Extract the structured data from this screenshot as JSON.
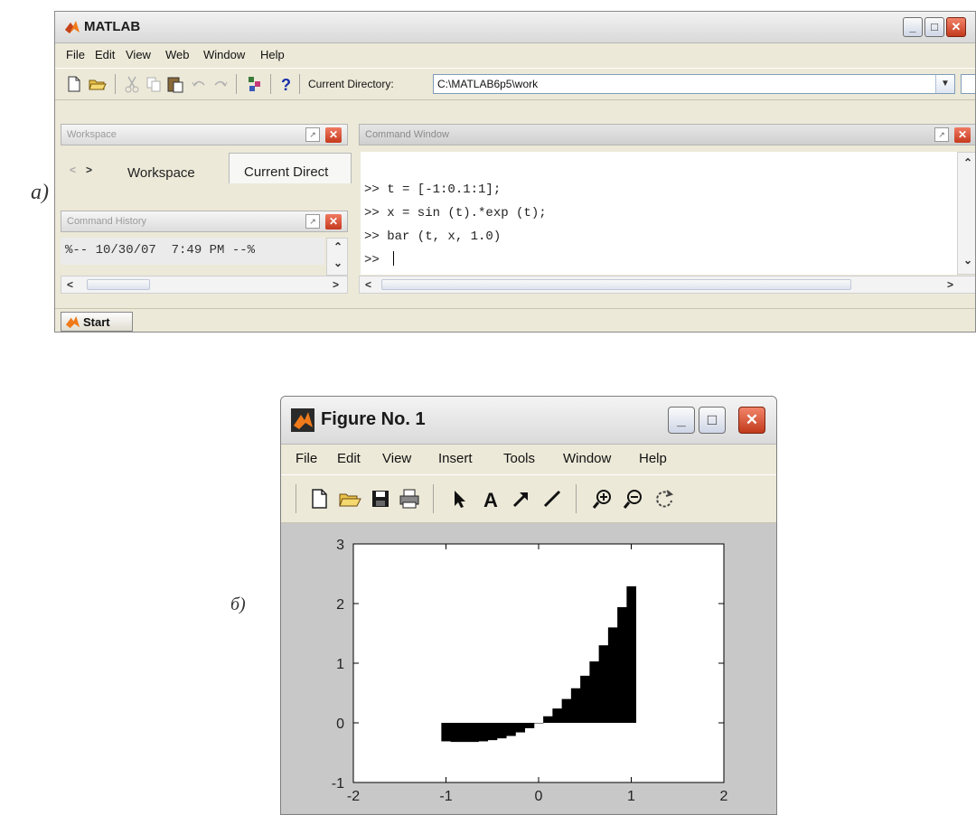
{
  "labels": {
    "a": "a)",
    "b": "б)"
  },
  "matlab": {
    "title": "MATLAB",
    "menu": [
      "File",
      "Edit",
      "View",
      "Web",
      "Window",
      "Help"
    ],
    "toolbar": {
      "current_directory_label": "Current Directory:",
      "current_directory_value": "C:\\MATLAB6p5\\work"
    },
    "workspace_panel": {
      "title": "Workspace",
      "tabs": [
        "Workspace",
        "Current Direct"
      ]
    },
    "history_panel": {
      "title": "Command History",
      "entry": "%-- 10/30/07  7:49 PM --%"
    },
    "command_window": {
      "title": "Command Window",
      "lines": [
        ">> t = [-1:0.1:1];",
        ">> x = sin (t).*exp (t);",
        ">> bar (t, x, 1.0)",
        ">> "
      ]
    },
    "start_label": "Start",
    "colors": {
      "accent": "#f07a1a",
      "close": "#d84a2a",
      "window_bg": "#ece9d8"
    }
  },
  "figure": {
    "title": "Figure No. 1",
    "menu": [
      "File",
      "Edit",
      "View",
      "Insert",
      "Tools",
      "Window",
      "Help"
    ],
    "toolbar_icons": [
      "new-file-icon",
      "open-folder-icon",
      "save-icon",
      "print-icon",
      "pointer-icon",
      "text-icon",
      "arrow-icon",
      "line-icon",
      "zoom-in-icon",
      "zoom-out-icon",
      "rotate-icon"
    ]
  },
  "chart_data": {
    "type": "bar",
    "x": [
      -1.0,
      -0.9,
      -0.8,
      -0.7,
      -0.6,
      -0.5,
      -0.4,
      -0.3,
      -0.2,
      -0.1,
      0.0,
      0.1,
      0.2,
      0.3,
      0.4,
      0.5,
      0.6,
      0.7,
      0.8,
      0.9,
      1.0
    ],
    "values": [
      -0.31,
      -0.32,
      -0.32,
      -0.32,
      -0.31,
      -0.29,
      -0.26,
      -0.22,
      -0.16,
      -0.09,
      0.0,
      0.11,
      0.24,
      0.4,
      0.58,
      0.79,
      1.03,
      1.3,
      1.6,
      1.94,
      2.29
    ],
    "bar_width": 1.0,
    "bar_color": "#000000",
    "xlim": [
      -2,
      2
    ],
    "ylim": [
      -1,
      3
    ],
    "xticks": [
      "-2",
      "-1",
      "0",
      "1",
      "2"
    ],
    "yticks": [
      "-1",
      "0",
      "1",
      "2",
      "3"
    ],
    "grid": false
  }
}
